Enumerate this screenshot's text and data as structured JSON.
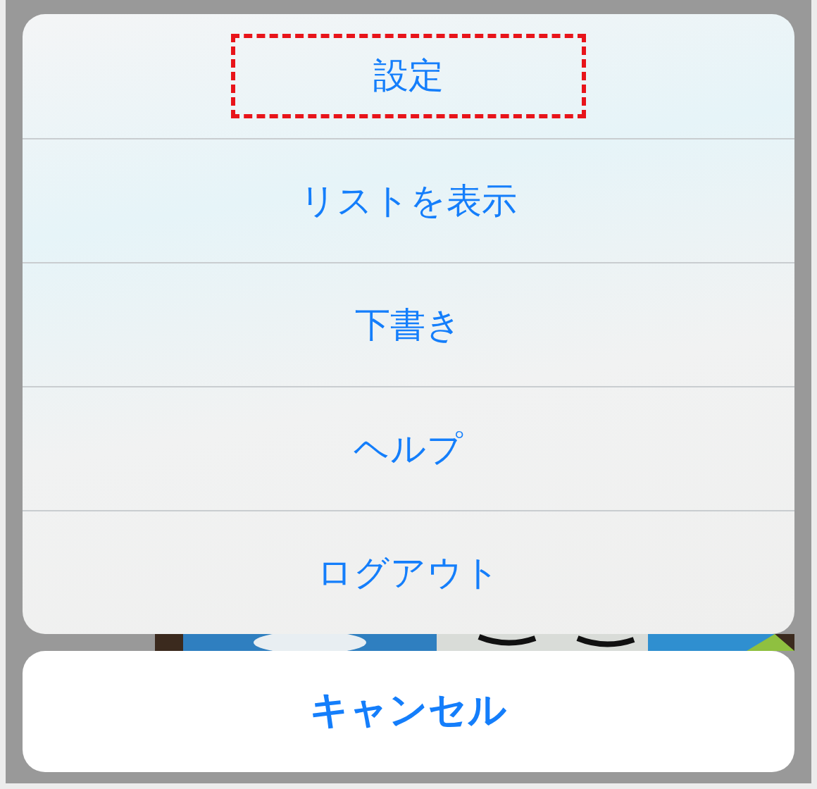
{
  "action_sheet": {
    "items": [
      {
        "label": "設定",
        "highlighted": true
      },
      {
        "label": "リストを表示",
        "highlighted": false
      },
      {
        "label": "下書き",
        "highlighted": false
      },
      {
        "label": "ヘルプ",
        "highlighted": false
      },
      {
        "label": "ログアウト",
        "highlighted": false
      }
    ]
  },
  "cancel_button": {
    "label": "キャンセル"
  }
}
